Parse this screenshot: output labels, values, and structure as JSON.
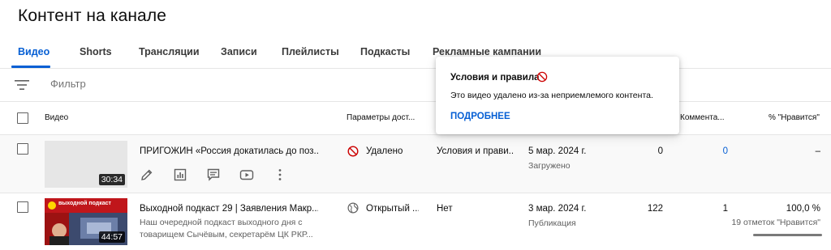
{
  "page": {
    "title": "Контент на канале"
  },
  "tabs": [
    {
      "label": "Видео",
      "active": true
    },
    {
      "label": "Shorts"
    },
    {
      "label": "Трансляции"
    },
    {
      "label": "Записи"
    },
    {
      "label": "Плейлисты"
    },
    {
      "label": "Подкасты"
    },
    {
      "label": "Рекламные кампании"
    }
  ],
  "filter": {
    "placeholder": "Фильтр",
    "icon": "filter-lines-icon"
  },
  "columns": {
    "video": "Видео",
    "visibility": "Параметры дост...",
    "comments": "Коммента...",
    "likes": "% \"Нравится\""
  },
  "rows": [
    {
      "title": "ПРИГОЖИН «Россия докатилась до поз...",
      "duration": "30:34",
      "visibility": "Удалено",
      "visibility_icon": "ban-icon",
      "restrictions": "Условия и прави...",
      "date": "5 мар. 2024 г.",
      "date_sub": "Загружено",
      "views": "0",
      "comments": "0",
      "likes": "–"
    },
    {
      "title": "Выходной подкаст 29 | Заявления Макр...",
      "description_line1": "Наш очередной подкаст выходного дня с",
      "description_line2": "товарищем Сычёвым, секретарём ЦК РКР...",
      "duration": "44:57",
      "thumb_caption": "выходной подкаст",
      "visibility": "Открытый ...",
      "visibility_icon": "globe-icon",
      "restrictions": "Нет",
      "date": "3 мар. 2024 г.",
      "date_sub": "Публикация",
      "views": "122",
      "comments": "1",
      "likes": "100,0 %",
      "likes_sub": "19 отметок \"Нравится\""
    }
  ],
  "popover": {
    "title": "Условия и правила",
    "body": "Это видео удалено из-за неприемлемого контента.",
    "link": "ПОДРОБНЕЕ"
  },
  "colors": {
    "accent": "#065fd4",
    "removed": "#cc0000"
  }
}
